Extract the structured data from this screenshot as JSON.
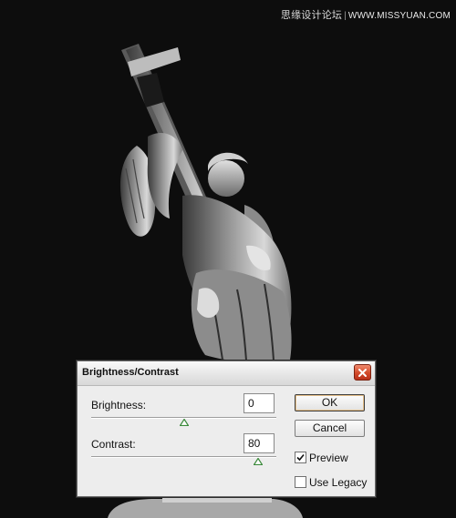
{
  "watermark": {
    "site_cn": "思缘设计论坛",
    "site_url": "WWW.MISSYUAN.COM"
  },
  "dialog": {
    "title": "Brightness/Contrast",
    "brightness": {
      "label": "Brightness:",
      "value": "0",
      "fraction": 0.5
    },
    "contrast": {
      "label": "Contrast:",
      "value": "80",
      "fraction": 0.9
    },
    "ok_label": "OK",
    "cancel_label": "Cancel",
    "preview": {
      "label": "Preview",
      "checked": true
    },
    "use_legacy": {
      "label": "Use Legacy",
      "checked": false
    }
  },
  "colors": {
    "background": "#0d0d0d",
    "close_button": "#d24a2a",
    "slider_thumb": "#3c8a3c"
  }
}
